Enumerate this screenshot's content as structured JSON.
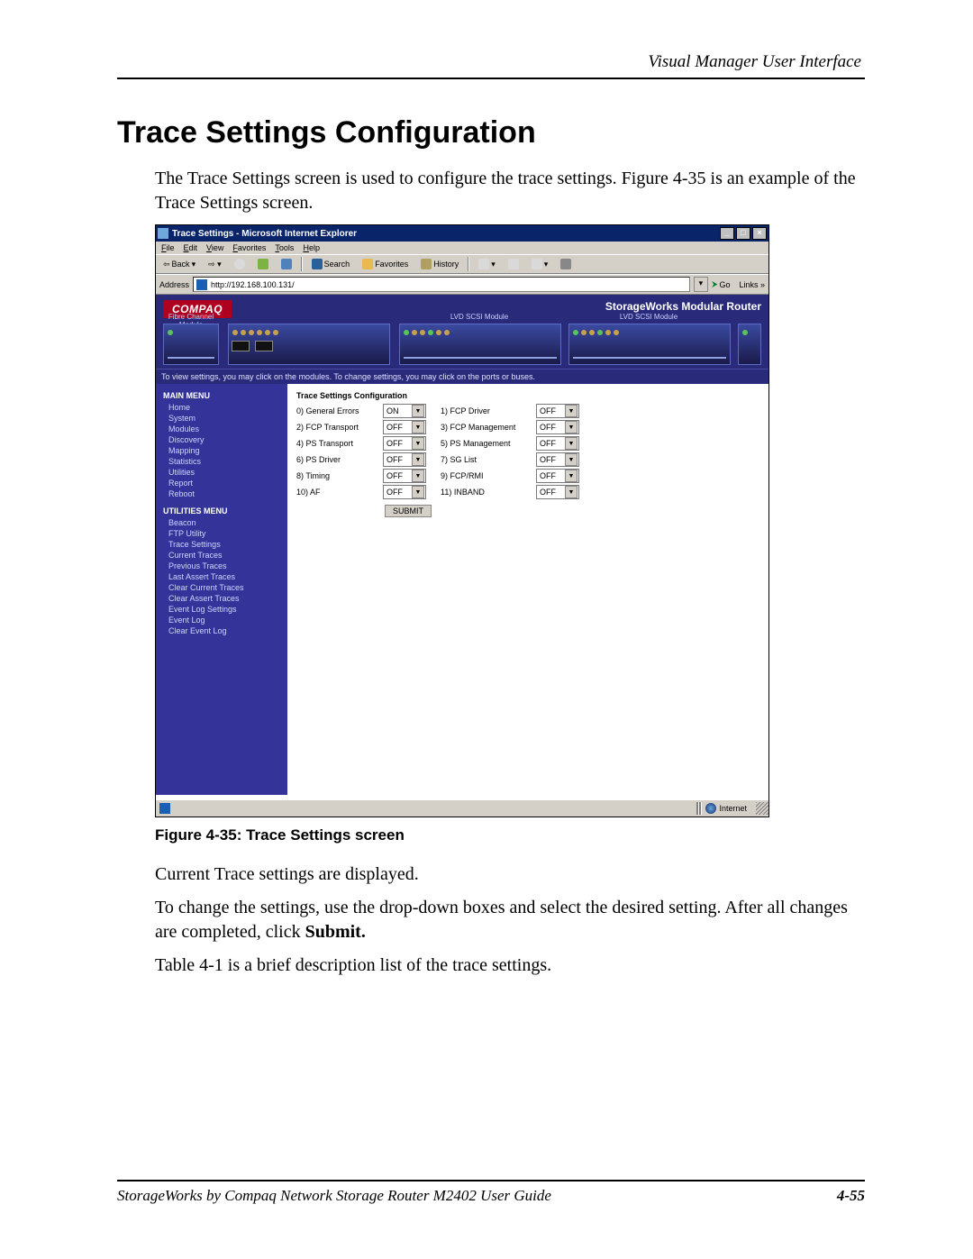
{
  "header": {
    "right": "Visual Manager User Interface"
  },
  "title": "Trace Settings Configuration",
  "intro": "The Trace Settings screen is used to configure the trace settings. Figure 4-35 is an example of the Trace Settings screen.",
  "figure": {
    "caption": "Figure 4-35:  Trace Settings screen",
    "browser": {
      "title": "Trace Settings - Microsoft Internet Explorer",
      "menus": [
        "File",
        "Edit",
        "View",
        "Favorites",
        "Tools",
        "Help"
      ],
      "toolbar": {
        "back": "Back",
        "search": "Search",
        "favorites": "Favorites",
        "history": "History"
      },
      "addressLabel": "Address",
      "addressValue": "http://192.168.100.131/",
      "go": "Go",
      "links": "Links"
    },
    "banner": {
      "logo": "COMPAQ",
      "product": "StorageWorks Modular Router",
      "modules": [
        "Fibre Channel Module",
        "",
        "LVD SCSI Module",
        "LVD SCSI Module"
      ],
      "hint": "To view settings, you may click on the modules. To change settings, you may click on the ports or buses."
    },
    "sidebar": {
      "mainHeader": "MAIN MENU",
      "mainItems": [
        "Home",
        "System",
        "Modules",
        "Discovery",
        "Mapping",
        "Statistics",
        "Utilities",
        "Report",
        "Reboot"
      ],
      "utilHeader": "UTILITIES MENU",
      "utilItems": [
        "Beacon",
        "FTP Utility",
        "Trace Settings",
        "Current Traces",
        "Previous Traces",
        "Last Assert Traces",
        "Clear Current Traces",
        "Clear Assert Traces",
        "Event Log Settings",
        "Event Log",
        "Clear Event Log"
      ]
    },
    "panel": {
      "title": "Trace Settings Configuration",
      "rows": [
        {
          "l1": "0) General Errors",
          "v1": "ON",
          "l2": "1) FCP Driver",
          "v2": "OFF"
        },
        {
          "l1": "2) FCP Transport",
          "v1": "OFF",
          "l2": "3) FCP Management",
          "v2": "OFF"
        },
        {
          "l1": "4) PS Transport",
          "v1": "OFF",
          "l2": "5) PS Management",
          "v2": "OFF"
        },
        {
          "l1": "6) PS Driver",
          "v1": "OFF",
          "l2": "7) SG List",
          "v2": "OFF"
        },
        {
          "l1": "8) Timing",
          "v1": "OFF",
          "l2": "9) FCP/RMI",
          "v2": "OFF"
        },
        {
          "l1": "10) AF",
          "v1": "OFF",
          "l2": "11) INBAND",
          "v2": "OFF"
        }
      ],
      "submit": "SUBMIT"
    },
    "statusbar": {
      "zone": "Internet"
    }
  },
  "after": [
    "Current Trace settings are displayed.",
    "To change the settings, use the drop-down boxes and select the desired setting. After all changes are completed, click ",
    "Submit.",
    "Table 4-1 is a brief description list of the trace settings."
  ],
  "footer": {
    "left": "StorageWorks by Compaq Network Storage Router M2402 User Guide",
    "right": "4-55"
  }
}
